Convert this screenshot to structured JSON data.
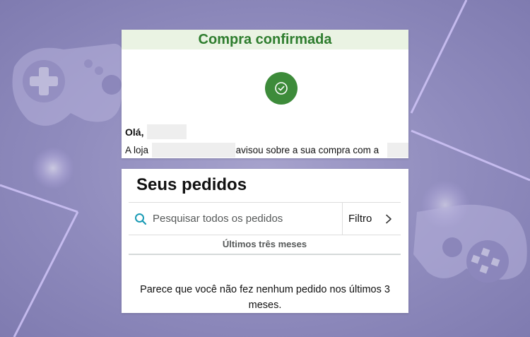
{
  "email": {
    "title": "Compra confirmada",
    "greeting": "Olá,",
    "notice_prefix": "A loja",
    "notice_middle": "avisou sobre a sua compra com a"
  },
  "orders": {
    "title": "Seus pedidos",
    "search_placeholder": "Pesquisar todos os pedidos",
    "filter_label": "Filtro",
    "period_label": "Últimos três meses",
    "empty_message": "Parece que você não fez nenhum pedido nos últimos 3 meses."
  },
  "colors": {
    "confirm_green": "#3d8b3a",
    "header_text_green": "#2e7d2e",
    "search_icon": "#1a9bb5"
  },
  "icons": [
    "check-icon",
    "search-icon",
    "chevron-right-icon",
    "gamepad-icon"
  ]
}
